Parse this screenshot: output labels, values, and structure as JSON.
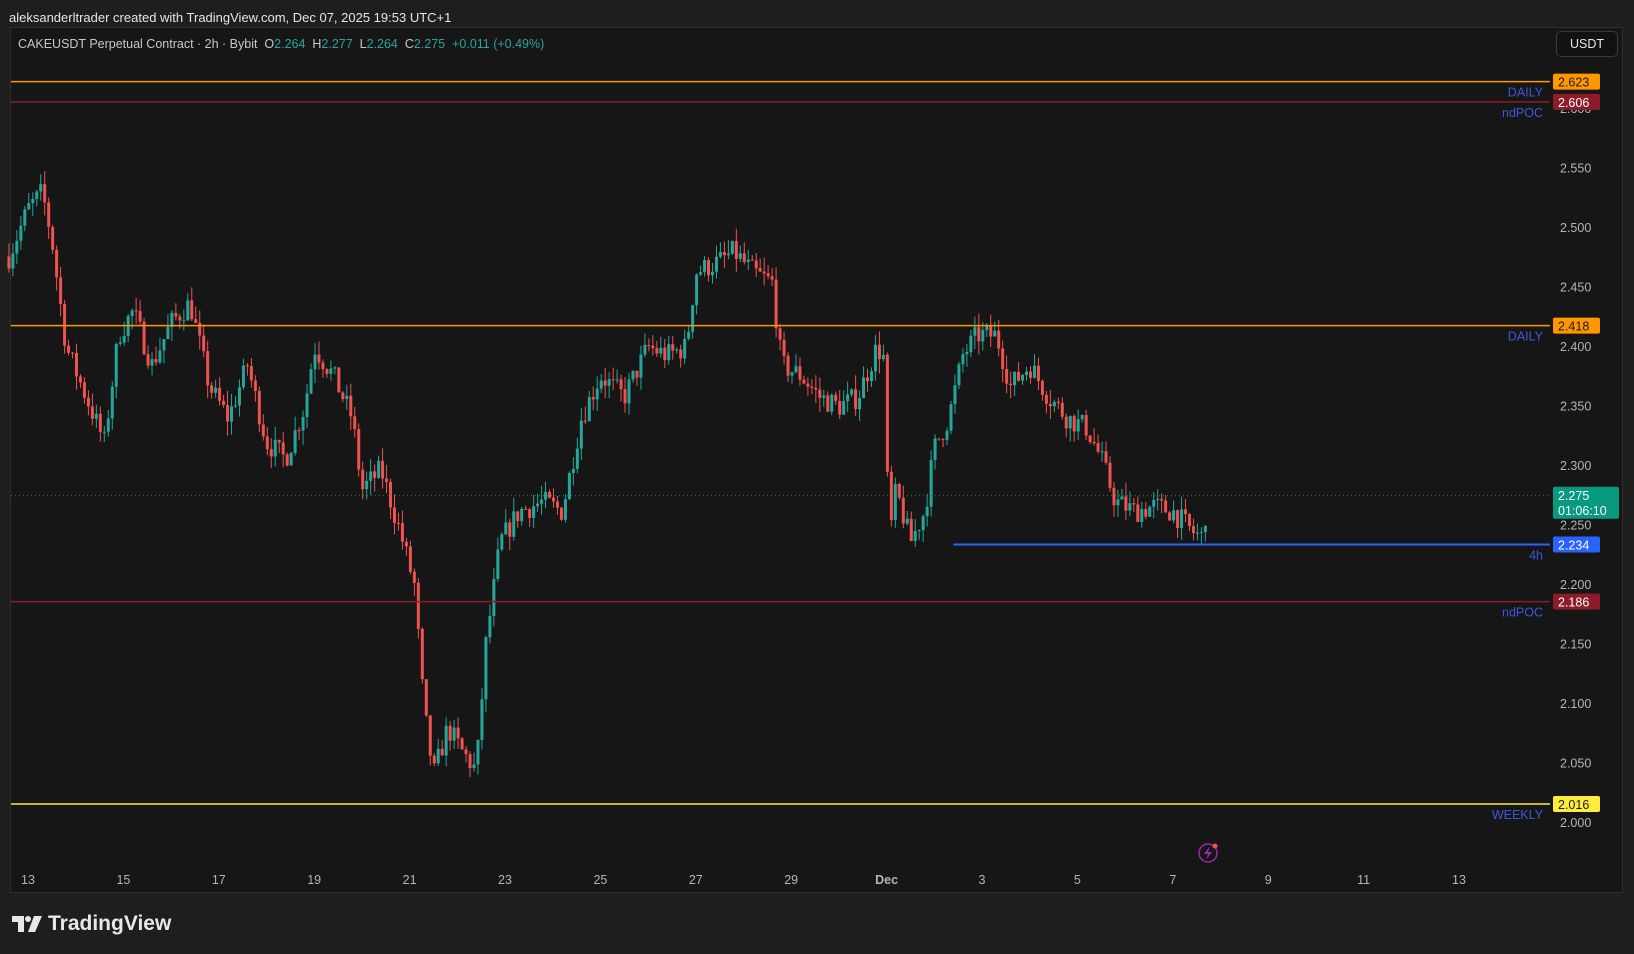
{
  "attribution": "aleksanderltrader created with TradingView.com, Dec 07, 2025 19:53 UTC+1",
  "legend": {
    "symbol": "CAKEUSDT Perpetual Contract · 2h · Bybit",
    "o_label": "O",
    "o": "2.264",
    "h_label": "H",
    "h": "2.277",
    "l_label": "L",
    "l": "2.264",
    "c_label": "C",
    "c": "2.275",
    "change": "+0.011 (+0.49%)"
  },
  "currency_button": "USDT",
  "logo_text": "TradingView",
  "colors": {
    "up": "#26a69a",
    "down": "#ef5350",
    "orange": "#ff9800",
    "darkred": "#8e1b28",
    "blue": "#2962ff",
    "yellow": "#ffeb3b",
    "label_blue": "#3a5bd9"
  },
  "chart_data": {
    "type": "candlestick",
    "timeframe": "2h",
    "ylim": [
      1.965,
      2.66
    ],
    "y_ticks": [
      "2.000",
      "2.050",
      "2.100",
      "2.150",
      "2.200",
      "2.250",
      "2.300",
      "2.350",
      "2.400",
      "2.450",
      "2.500",
      "2.550",
      "2.600"
    ],
    "x_ticks": [
      {
        "label": "13",
        "day": 13
      },
      {
        "label": "15",
        "day": 15
      },
      {
        "label": "17",
        "day": 17
      },
      {
        "label": "19",
        "day": 19
      },
      {
        "label": "21",
        "day": 21
      },
      {
        "label": "23",
        "day": 23
      },
      {
        "label": "25",
        "day": 25
      },
      {
        "label": "27",
        "day": 27
      },
      {
        "label": "29",
        "day": 29
      },
      {
        "label": "Dec",
        "day": 31
      },
      {
        "label": "3",
        "day": 33
      },
      {
        "label": "5",
        "day": 35
      },
      {
        "label": "7",
        "day": 37
      },
      {
        "label": "9",
        "day": 39
      },
      {
        "label": "11",
        "day": 41
      },
      {
        "label": "13",
        "day": 43
      }
    ],
    "price_path_note_days": "days counted from Nov (Dec 1 = 31)",
    "price_path": [
      [
        12.6,
        2.476
      ],
      [
        13.0,
        2.516
      ],
      [
        13.3,
        2.53
      ],
      [
        13.5,
        2.49
      ],
      [
        13.8,
        2.4
      ],
      [
        14.2,
        2.36
      ],
      [
        14.6,
        2.32
      ],
      [
        14.9,
        2.41
      ],
      [
        15.2,
        2.43
      ],
      [
        15.6,
        2.385
      ],
      [
        16.0,
        2.42
      ],
      [
        16.4,
        2.437
      ],
      [
        16.8,
        2.367
      ],
      [
        17.2,
        2.34
      ],
      [
        17.6,
        2.385
      ],
      [
        18.0,
        2.32
      ],
      [
        18.4,
        2.306
      ],
      [
        18.8,
        2.35
      ],
      [
        19.0,
        2.4
      ],
      [
        19.4,
        2.376
      ],
      [
        19.8,
        2.34
      ],
      [
        20.0,
        2.28
      ],
      [
        20.4,
        2.297
      ],
      [
        20.8,
        2.245
      ],
      [
        21.1,
        2.2
      ],
      [
        21.3,
        2.096
      ],
      [
        21.5,
        2.04
      ],
      [
        21.8,
        2.08
      ],
      [
        22.1,
        2.06
      ],
      [
        22.4,
        2.044
      ],
      [
        22.6,
        2.15
      ],
      [
        22.9,
        2.236
      ],
      [
        23.3,
        2.262
      ],
      [
        23.8,
        2.27
      ],
      [
        24.2,
        2.262
      ],
      [
        24.6,
        2.34
      ],
      [
        25.0,
        2.376
      ],
      [
        25.5,
        2.358
      ],
      [
        26.0,
        2.4
      ],
      [
        26.4,
        2.393
      ],
      [
        26.8,
        2.4
      ],
      [
        27.0,
        2.463
      ],
      [
        27.5,
        2.472
      ],
      [
        27.8,
        2.48
      ],
      [
        28.2,
        2.463
      ],
      [
        28.6,
        2.454
      ],
      [
        28.8,
        2.385
      ],
      [
        29.2,
        2.376
      ],
      [
        29.6,
        2.358
      ],
      [
        30.0,
        2.35
      ],
      [
        30.4,
        2.358
      ],
      [
        30.8,
        2.4
      ],
      [
        30.95,
        2.39
      ],
      [
        31.05,
        2.236
      ],
      [
        31.2,
        2.28
      ],
      [
        31.5,
        2.236
      ],
      [
        31.8,
        2.262
      ],
      [
        32.0,
        2.315
      ],
      [
        32.3,
        2.34
      ],
      [
        32.6,
        2.393
      ],
      [
        32.9,
        2.41
      ],
      [
        33.3,
        2.41
      ],
      [
        33.6,
        2.367
      ],
      [
        34.0,
        2.385
      ],
      [
        34.4,
        2.358
      ],
      [
        34.8,
        2.34
      ],
      [
        35.2,
        2.332
      ],
      [
        35.5,
        2.306
      ],
      [
        35.8,
        2.27
      ],
      [
        36.2,
        2.262
      ],
      [
        36.6,
        2.266
      ],
      [
        37.0,
        2.262
      ],
      [
        37.4,
        2.245
      ],
      [
        37.6,
        2.24
      ],
      [
        37.75,
        2.275
      ]
    ],
    "levels": [
      {
        "price": 2.623,
        "label": "2.623",
        "tag": "DAILY",
        "color": "#ff9800",
        "text_color": "#1a1a1a"
      },
      {
        "price": 2.606,
        "label": "2.606",
        "tag": "ndPOC",
        "color": "#8e1b28",
        "text_color": "#ffffff"
      },
      {
        "price": 2.418,
        "label": "2.418",
        "tag": "DAILY",
        "color": "#ff9800",
        "text_color": "#1a1a1a"
      },
      {
        "price": 2.234,
        "label": "2.234",
        "tag": "4h",
        "color": "#2962ff",
        "text_color": "#ffffff",
        "from_day": 32.4
      },
      {
        "price": 2.186,
        "label": "2.186",
        "tag": "ndPOC",
        "color": "#8e1b28",
        "text_color": "#ffffff"
      },
      {
        "price": 2.016,
        "label": "2.016",
        "tag": "WEEKLY",
        "color": "#ffeb3b",
        "text_color": "#1a1a1a"
      }
    ],
    "last_price": {
      "price": 2.275,
      "label": "2.275",
      "countdown": "01:06:10",
      "color": "#089981"
    }
  }
}
